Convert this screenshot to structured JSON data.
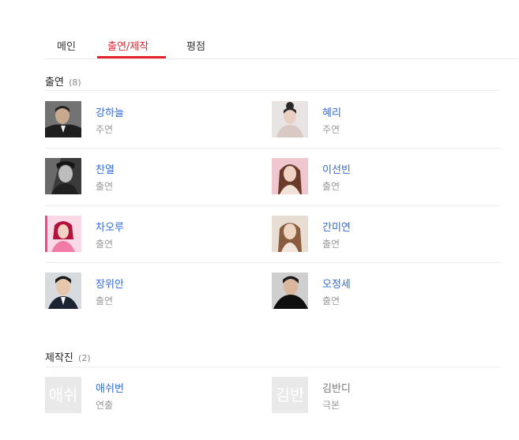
{
  "tabs": [
    {
      "label": "메인"
    },
    {
      "label": "출연/제작"
    },
    {
      "label": "평점"
    }
  ],
  "colors": {
    "accent": "#e4232f",
    "link": "#2f6bd9",
    "muted": "#9a9a9a"
  },
  "cast_section": {
    "title": "출연",
    "count": "(8)",
    "people": [
      {
        "name": "강하늘",
        "role": "주연"
      },
      {
        "name": "혜리",
        "role": "주연"
      },
      {
        "name": "찬열",
        "role": "출연"
      },
      {
        "name": "이선빈",
        "role": "출연"
      },
      {
        "name": "차오루",
        "role": "출연"
      },
      {
        "name": "간미연",
        "role": "출연"
      },
      {
        "name": "장위안",
        "role": "출연"
      },
      {
        "name": "오정세",
        "role": "출연"
      }
    ]
  },
  "crew_section": {
    "title": "제작진",
    "count": "(2)",
    "people": [
      {
        "name": "애쉬번",
        "role": "연출",
        "placeholder": "애쉬"
      },
      {
        "name": "김반디",
        "role": "극본",
        "placeholder": "김반"
      }
    ]
  }
}
